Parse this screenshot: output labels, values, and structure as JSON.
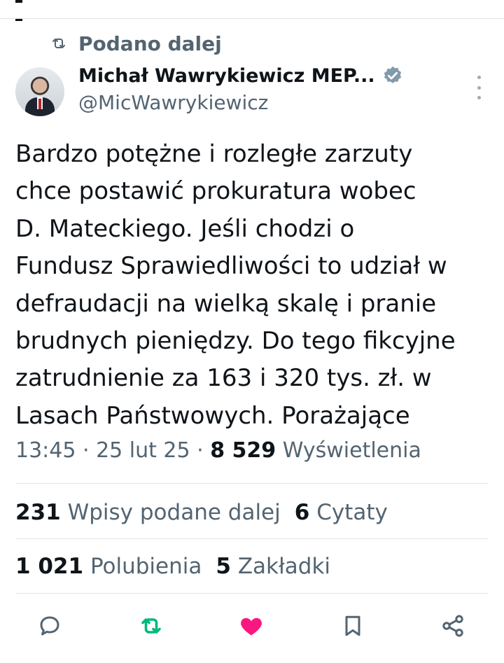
{
  "retweet_context": {
    "label": "Podano dalej",
    "icon": "repost-icon"
  },
  "author": {
    "name": "Michał Wawrykiewicz MEP...",
    "handle": "@MicWawrykiewicz",
    "verified": true,
    "verified_color": "#829aab"
  },
  "tweet": {
    "lines": [
      "Bardzo potężne i rozległe zarzuty",
      "chce postawić prokuratura wobec",
      "D. Mateckiego. Jeśli chodzi o",
      "Fundusz Sprawiedliwości to udział w",
      "defraudacji na wielką skalę i pranie",
      "brudnych pieniędzy. Do tego fikcyjne",
      "zatrudnienie za 163 i 320 tys. zł. w",
      "Lasach Państwowych. Porażające"
    ]
  },
  "meta": {
    "time": "13:45",
    "separator": " · ",
    "date": "25 lut 25",
    "views_count": "8 529",
    "views_label": "Wyświetlenia"
  },
  "stats_row1": {
    "reposts_count": "231",
    "reposts_label": "Wpisy podane dalej",
    "quotes_count": "6",
    "quotes_label": "Cytaty"
  },
  "stats_row2": {
    "likes_count": "1 021",
    "likes_label": "Polubienia",
    "bookmarks_count": "5",
    "bookmarks_label": "Zakładki"
  },
  "colors": {
    "text": "#0f1419",
    "muted": "#536471",
    "divider": "#e1e5e8",
    "repost_active": "#00ba7c",
    "like_active": "#f91880"
  },
  "actions": [
    "reply-icon",
    "repost-icon",
    "like-icon",
    "bookmark-icon",
    "share-icon"
  ]
}
